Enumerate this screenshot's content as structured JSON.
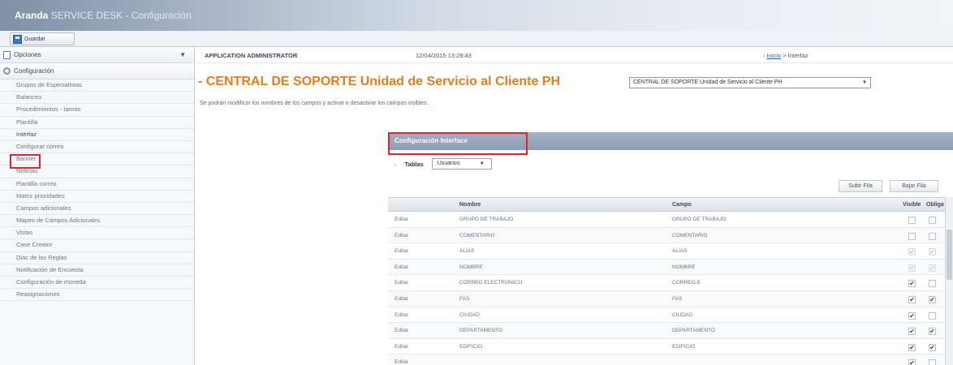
{
  "window": {
    "brand": "Aranda",
    "subtitle": "SERVICE DESK - Configuración"
  },
  "toolbar": {
    "save_label": "Guardar"
  },
  "sidebar": {
    "options_label": "Opciones",
    "section_label": "Configuración",
    "items": [
      "Grupos de Especialistas",
      "Balanceo",
      "Procedimientos - tareas",
      "Plantilla",
      "Interfaz",
      "Configurar correo",
      "Banner",
      "Noticias",
      "Plantilla correo",
      "Matriz prioridades",
      "Campos adicionales",
      "Mapeo de Campos Adicionales",
      "Vistas",
      "Case Creator",
      "Diac de las Reglas",
      "Notificación de Encuesta",
      "Configuración de moneda",
      "Reasignaciones"
    ],
    "selected": "Interfaz"
  },
  "header": {
    "user": "APPLICATION ADMINISTRATOR",
    "datetime": "12/04/2015 13:28:43",
    "breadcrumb_home": "Inicio",
    "breadcrumb_sep": " > ",
    "breadcrumb_current": "Interfaz"
  },
  "page": {
    "title": "CENTRAL DE SOPORTE Unidad de Servicio al Cliente PH",
    "project_select": "CENTRAL DE SOPORTE Unidad de Servicio al Cliente PH",
    "instructions": "Se podrán modificar los nombres de los campos y activar o desactivar los campos visibles ."
  },
  "panel": {
    "title": "Configuración Interface",
    "tables_label": "Tablas",
    "tables_value": "Usuarios",
    "btn_up": "Subir Fila",
    "btn_down": "Bajar Fila",
    "columns": {
      "name": "Nombre",
      "field": "Campo",
      "visible": "Visible",
      "required": "Obliga"
    },
    "edit_label": "Editar",
    "rows": [
      {
        "name": "GRUPO DE TRABAJO",
        "field": "GRUPO DE TRABAJO",
        "visible": "off",
        "required": "off"
      },
      {
        "name": "COMENTARIO",
        "field": "COMENTARIO",
        "visible": "off",
        "required": "off"
      },
      {
        "name": "ALIAS",
        "field": "ALIAS",
        "visible": "disabled",
        "required": "disabled"
      },
      {
        "name": "NOMBRE",
        "field": "NOMBRE",
        "visible": "disabled",
        "required": "disabled"
      },
      {
        "name": "CORREO ELECTRONICO",
        "field": "CORREO-E",
        "visible": "on",
        "required": "off"
      },
      {
        "name": "FAS",
        "field": "FAS",
        "visible": "on",
        "required": "on"
      },
      {
        "name": "CIUDAD",
        "field": "CIUDAD",
        "visible": "on",
        "required": "off"
      },
      {
        "name": "DEPARTAMENTO",
        "field": "DEPARTAMENTO",
        "visible": "on",
        "required": "on"
      },
      {
        "name": "EDIFICIO",
        "field": "EDIFICIO",
        "visible": "on",
        "required": "on"
      },
      {
        "name": "",
        "field": "",
        "visible": "on",
        "required": "off"
      }
    ]
  },
  "colors": {
    "accent": "#e77b1b",
    "highlight": "#d8262f",
    "header": "#8e9cb2"
  },
  "icons": {
    "save": "save-disk-icon",
    "options": "options-icon",
    "section": "gear-icon"
  }
}
